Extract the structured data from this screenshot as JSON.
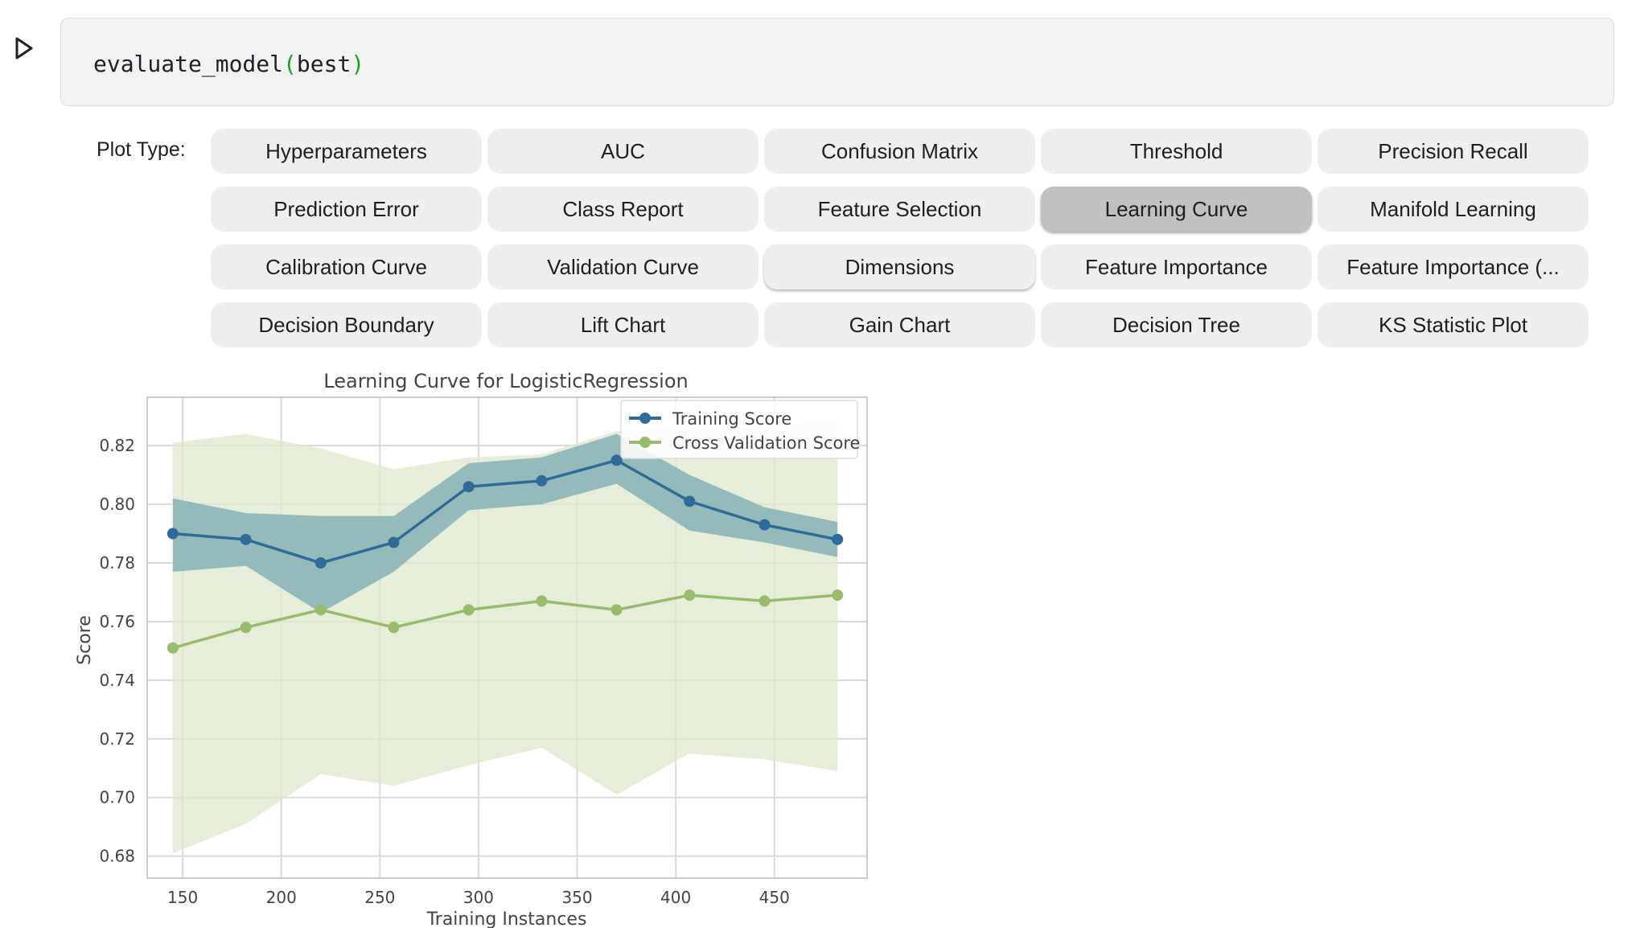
{
  "cell": {
    "code_name": "evaluate_model",
    "code_open": "(",
    "code_arg": "best",
    "code_close": ")"
  },
  "widget": {
    "label": "Plot Type:",
    "buttons": [
      "Hyperparameters",
      "AUC",
      "Confusion Matrix",
      "Threshold",
      "Precision Recall",
      "Prediction Error",
      "Class Report",
      "Feature Selection",
      "Learning Curve",
      "Manifold Learning",
      "Calibration Curve",
      "Validation Curve",
      "Dimensions",
      "Feature Importance",
      "Feature Importance (...",
      "Decision Boundary",
      "Lift Chart",
      "Gain Chart",
      "Decision Tree",
      "KS Statistic Plot"
    ],
    "active_button": "Learning Curve"
  },
  "chart_data": {
    "type": "line",
    "title": "Learning Curve for LogisticRegression",
    "xlabel": "Training Instances",
    "ylabel": "Score",
    "x": [
      145,
      182,
      220,
      257,
      295,
      332,
      370,
      407,
      445,
      482
    ],
    "xlim": [
      132,
      497
    ],
    "ylim": [
      0.6725,
      0.8365
    ],
    "xticks": [
      150,
      200,
      250,
      300,
      350,
      400,
      450
    ],
    "yticks": [
      0.68,
      0.7,
      0.72,
      0.74,
      0.76,
      0.78,
      0.8,
      0.82
    ],
    "ytick_labels": [
      "0.68",
      "0.70",
      "0.72",
      "0.74",
      "0.76",
      "0.78",
      "0.80",
      "0.82"
    ],
    "grid": true,
    "legend_position": "top-right",
    "series": [
      {
        "name": "Training Score",
        "color": "#2e6b99",
        "band_color": "#7aa8b0",
        "values": [
          0.79,
          0.788,
          0.78,
          0.787,
          0.806,
          0.808,
          0.815,
          0.801,
          0.793,
          0.788
        ],
        "upper": [
          0.802,
          0.797,
          0.796,
          0.796,
          0.814,
          0.816,
          0.824,
          0.81,
          0.799,
          0.794
        ],
        "lower": [
          0.777,
          0.779,
          0.763,
          0.777,
          0.798,
          0.8,
          0.807,
          0.791,
          0.787,
          0.782
        ]
      },
      {
        "name": "Cross Validation Score",
        "color": "#99bb6e",
        "band_color": "#dde8cc",
        "values": [
          0.751,
          0.758,
          0.764,
          0.758,
          0.764,
          0.767,
          0.764,
          0.769,
          0.767,
          0.769
        ],
        "upper": [
          0.821,
          0.824,
          0.819,
          0.812,
          0.816,
          0.817,
          0.825,
          0.826,
          0.826,
          0.829
        ],
        "lower": [
          0.681,
          0.691,
          0.708,
          0.704,
          0.711,
          0.717,
          0.701,
          0.715,
          0.713,
          0.709
        ]
      }
    ]
  }
}
